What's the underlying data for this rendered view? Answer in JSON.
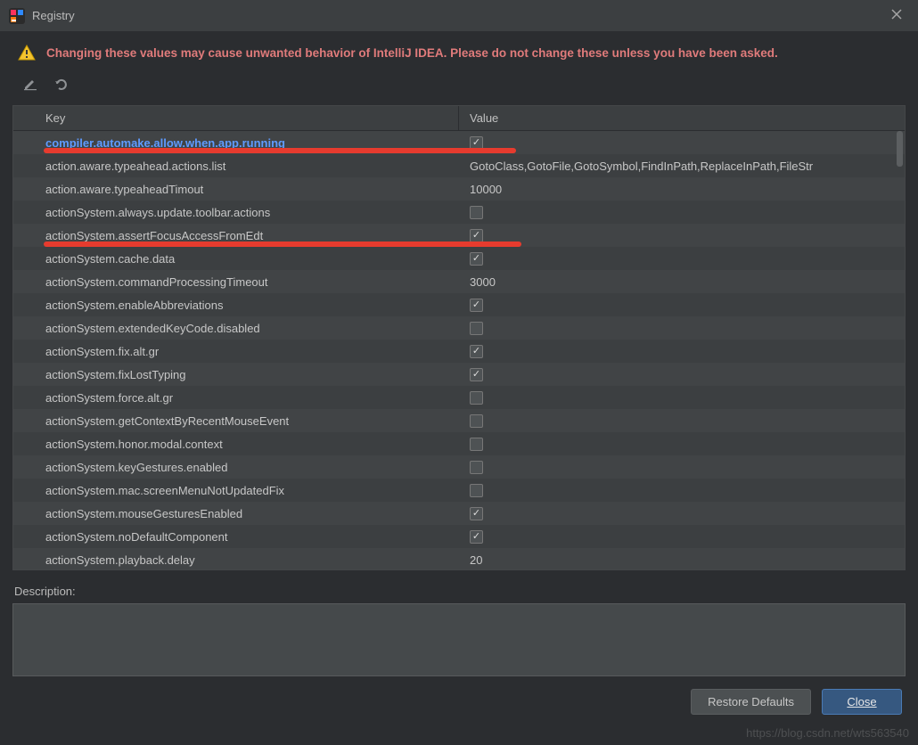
{
  "window": {
    "title": "Registry"
  },
  "warning": "Changing these values may cause unwanted behavior of IntelliJ IDEA. Please do not change these unless you have been asked.",
  "columns": {
    "key": "Key",
    "value": "Value"
  },
  "rows": [
    {
      "key": "compiler.automake.allow.when.app.running",
      "type": "check",
      "checked": true,
      "highlighted": true
    },
    {
      "key": "action.aware.typeahead.actions.list",
      "type": "text",
      "value": "GotoClass,GotoFile,GotoSymbol,FindInPath,ReplaceInPath,FileStr"
    },
    {
      "key": "action.aware.typeaheadTimout",
      "type": "text",
      "value": "10000"
    },
    {
      "key": "actionSystem.always.update.toolbar.actions",
      "type": "check",
      "checked": false
    },
    {
      "key": "actionSystem.assertFocusAccessFromEdt",
      "type": "check",
      "checked": true
    },
    {
      "key": "actionSystem.cache.data",
      "type": "check",
      "checked": true
    },
    {
      "key": "actionSystem.commandProcessingTimeout",
      "type": "text",
      "value": "3000"
    },
    {
      "key": "actionSystem.enableAbbreviations",
      "type": "check",
      "checked": true
    },
    {
      "key": "actionSystem.extendedKeyCode.disabled",
      "type": "check",
      "checked": false
    },
    {
      "key": "actionSystem.fix.alt.gr",
      "type": "check",
      "checked": true
    },
    {
      "key": "actionSystem.fixLostTyping",
      "type": "check",
      "checked": true
    },
    {
      "key": "actionSystem.force.alt.gr",
      "type": "check",
      "checked": false
    },
    {
      "key": "actionSystem.getContextByRecentMouseEvent",
      "type": "check",
      "checked": false
    },
    {
      "key": "actionSystem.honor.modal.context",
      "type": "check",
      "checked": false
    },
    {
      "key": "actionSystem.keyGestures.enabled",
      "type": "check",
      "checked": false
    },
    {
      "key": "actionSystem.mac.screenMenuNotUpdatedFix",
      "type": "check",
      "checked": false
    },
    {
      "key": "actionSystem.mouseGesturesEnabled",
      "type": "check",
      "checked": true
    },
    {
      "key": "actionSystem.noDefaultComponent",
      "type": "check",
      "checked": true
    },
    {
      "key": "actionSystem.playback.delay",
      "type": "text",
      "value": "20"
    }
  ],
  "description_label": "Description:",
  "buttons": {
    "restore": "Restore Defaults",
    "close": "Close"
  },
  "watermark": "https://blog.csdn.net/wts563540"
}
